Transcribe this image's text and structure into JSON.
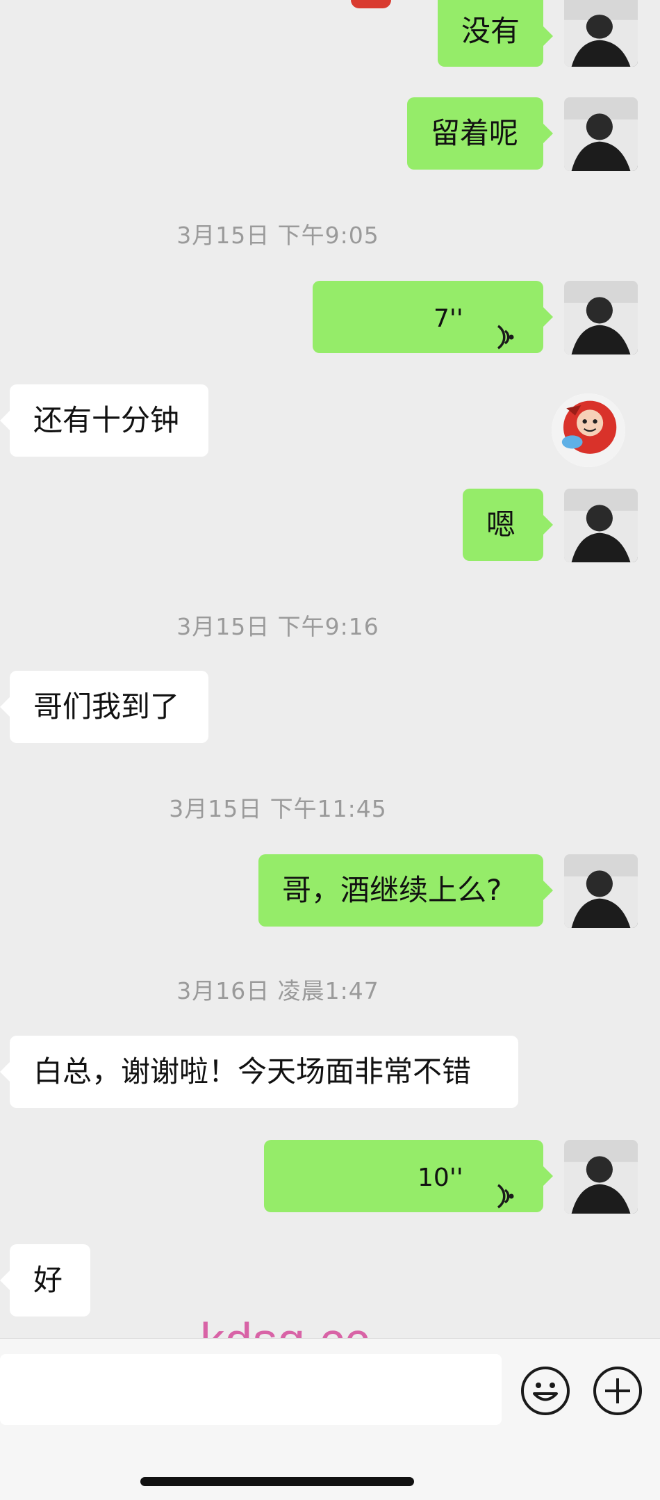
{
  "messages": {
    "m1": "没有",
    "m2": "留着呢",
    "ts1": "3月15日 下午9:05",
    "voice1": "7''",
    "m3": "还有十分钟",
    "m4": "嗯",
    "ts2": "3月15日 下午9:16",
    "m5": "哥们我到了",
    "ts3": "3月15日 下午11:45",
    "m6": "哥，酒继续上么?",
    "ts4": "3月16日 凌晨1:47",
    "m7": "白总，谢谢啦！今天场面非常不错",
    "voice2": "10''",
    "m8": "好"
  },
  "watermark": "kdsq.cc",
  "input": {
    "placeholder": ""
  },
  "icons": {
    "emoji": "smiley-icon",
    "add": "plus-circle-icon"
  },
  "colors": {
    "sent": "#95ec69",
    "received": "#ffffff",
    "background": "#ededed",
    "timestamp": "#9a9a9a"
  }
}
